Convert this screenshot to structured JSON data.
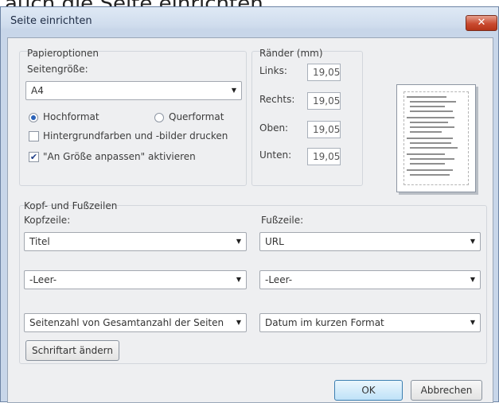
{
  "caption": "auch die Seite einrichten.",
  "dialog": {
    "title": "Seite einrichten",
    "close_label": "✕"
  },
  "paper_options": {
    "group_label": "Papieroptionen",
    "page_size_label": "Seitengröße:",
    "page_size_value": "A4",
    "orientation_portrait": "Hochformat",
    "orientation_landscape": "Querformat",
    "orientation_selected": "Hochformat",
    "print_backgrounds_label": "Hintergrundfarben und -bilder drucken",
    "print_backgrounds_checked": false,
    "fit_label": "\"An Größe anpassen\" aktivieren",
    "fit_checked": true
  },
  "margins": {
    "group_label": "Ränder (mm)",
    "left_label": "Links:",
    "left_value": "19,05",
    "right_label": "Rechts:",
    "right_value": "19,05",
    "top_label": "Oben:",
    "top_value": "19,05",
    "bottom_label": "Unten:",
    "bottom_value": "19,05"
  },
  "header_footer": {
    "group_label": "Kopf- und Fußzeilen",
    "header_label": "Kopfzeile:",
    "footer_label": "Fußzeile:",
    "header_values": [
      "Titel",
      "-Leer-",
      "Seitenzahl von Gesamtanzahl der Seiten"
    ],
    "footer_values": [
      "URL",
      "-Leer-",
      "Datum im kurzen Format"
    ],
    "font_button": "Schriftart ändern"
  },
  "buttons": {
    "ok": "OK",
    "cancel": "Abbrechen"
  }
}
